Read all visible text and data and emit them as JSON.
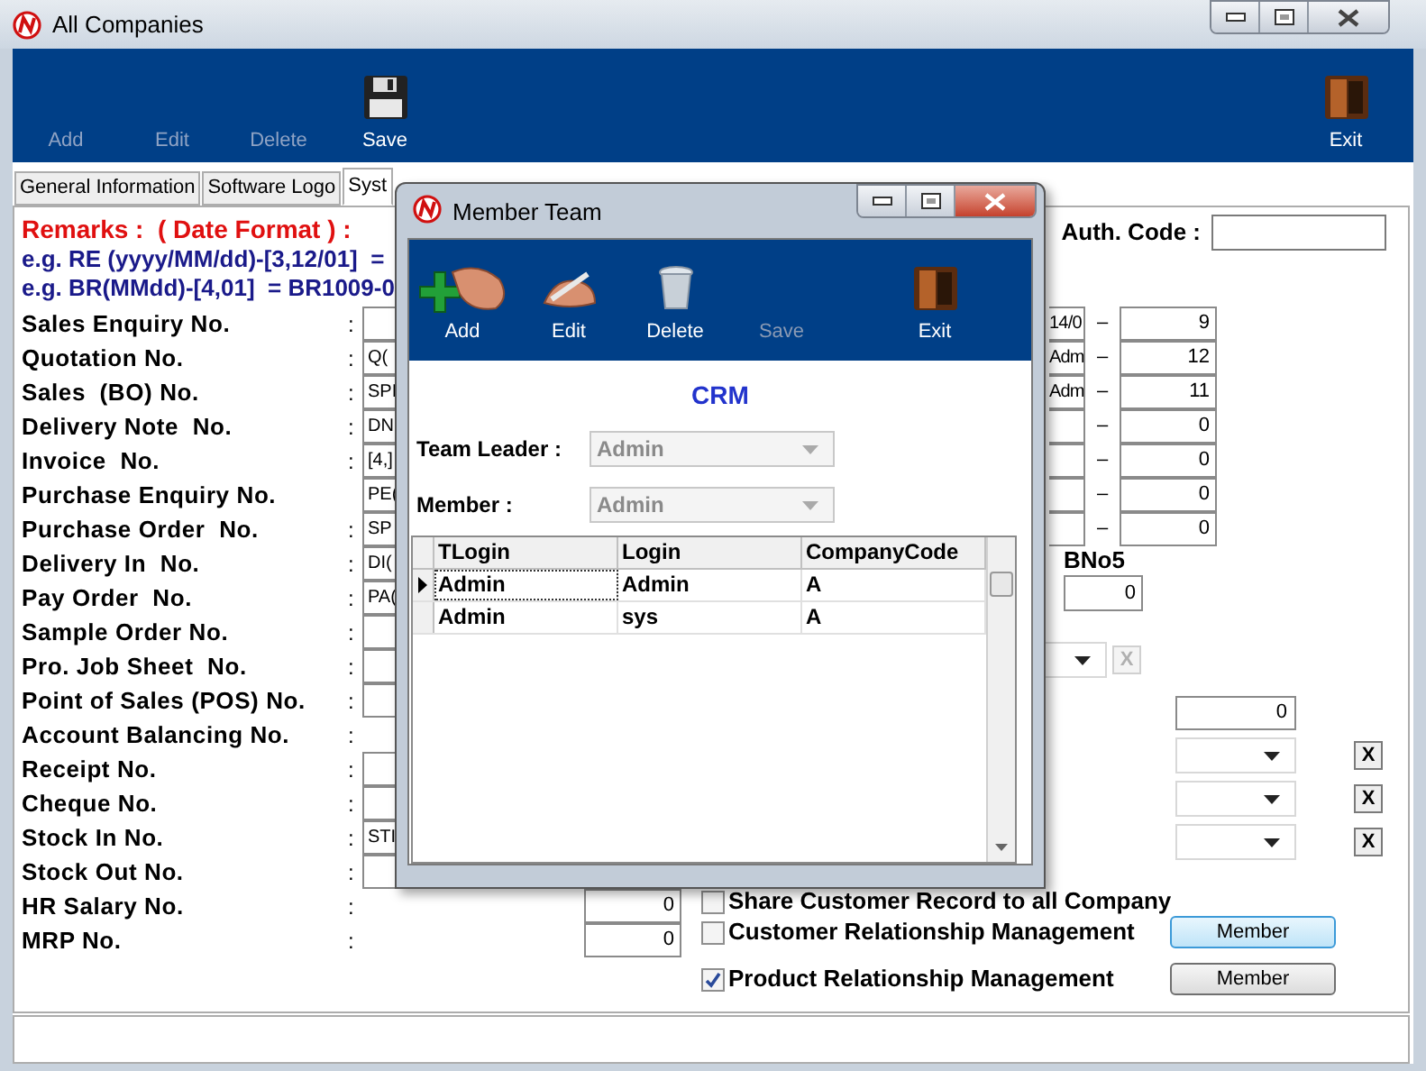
{
  "window": {
    "title": "All Companies"
  },
  "toolbar": [
    {
      "kind": "add",
      "label": "Add",
      "disabled": true
    },
    {
      "kind": "edit",
      "label": "Edit",
      "disabled": true
    },
    {
      "kind": "delete",
      "label": "Delete",
      "disabled": true
    },
    {
      "kind": "save",
      "label": "Save",
      "disabled": false
    },
    {
      "kind": "exit",
      "label": "Exit",
      "disabled": false
    }
  ],
  "tabs": [
    {
      "label": "General Information",
      "selected": false
    },
    {
      "label": "Software Logo",
      "selected": false
    },
    {
      "label": "Syst",
      "selected": true
    }
  ],
  "remarks": {
    "title": "Remarks :  ( Date Format ) :",
    "examples": [
      "e.g. RE (yyyy/MM/dd)-[3,12/01]  =",
      "e.g. BR(MMdd)-[4,01]  = BR1009-0"
    ]
  },
  "auth_code": {
    "label": "Auth. Code :"
  },
  "numbering": [
    {
      "label": "Sales Enquiry No.",
      "colon": ":",
      "kind": "field"
    },
    {
      "label": "Quotation No.",
      "colon": ":",
      "kind": "field",
      "value": "Q("
    },
    {
      "label": "Sales  (BO) No.",
      "colon": ":",
      "kind": "field",
      "value": "SPI"
    },
    {
      "label": "Delivery Note  No.",
      "colon": ":",
      "kind": "field",
      "value": "DN"
    },
    {
      "label": "Invoice  No.",
      "colon": ":",
      "kind": "field",
      "value": "[4,]"
    },
    {
      "label": "Purchase Enquiry No.",
      "kind": "field",
      "value": "PE("
    },
    {
      "label": "Purchase Order  No.",
      "colon": ":",
      "kind": "field",
      "value": "SP"
    },
    {
      "label": "Delivery In  No.",
      "colon": ":",
      "kind": "field",
      "value": "DI("
    },
    {
      "label": "Pay Order  No.",
      "colon": ":",
      "kind": "field",
      "value": "PA("
    },
    {
      "label": "Sample Order No.",
      "colon": ":",
      "kind": "field"
    },
    {
      "label": "Pro. Job Sheet  No.",
      "colon": ":",
      "kind": "field"
    },
    {
      "label": "Point of Sales (POS) No.",
      "colon": ":",
      "kind": "field"
    },
    {
      "label": "Account Balancing No.",
      "colon": ":",
      "kind": "plain"
    },
    {
      "label": "Receipt No.",
      "colon": ":",
      "kind": "field"
    },
    {
      "label": "Cheque No.",
      "colon": ":",
      "kind": "field"
    },
    {
      "label": "Stock In No.",
      "colon": ":",
      "kind": "field",
      "value": "STI"
    },
    {
      "label": "Stock Out No.",
      "colon": ":",
      "kind": "field"
    },
    {
      "label": "HR Salary No.",
      "colon": ":",
      "kind": "number",
      "value": "0"
    },
    {
      "label": "MRP No.",
      "colon": ":",
      "kind": "number",
      "value": "0"
    }
  ],
  "counters": [
    {
      "prefix": "14/0",
      "dash": "–",
      "value": "9"
    },
    {
      "prefix": "Adm",
      "dash": "–",
      "value": "12"
    },
    {
      "prefix": "Adm",
      "dash": "–",
      "value": "11"
    },
    {
      "dash": "–",
      "value": "0"
    },
    {
      "dash": "–",
      "value": "0"
    },
    {
      "dash": "–",
      "value": "0"
    },
    {
      "dash": "–",
      "value": "0"
    }
  ],
  "bno5": {
    "label": "BNo5",
    "value": "0"
  },
  "combo_rows": [
    {
      "kind": "combo",
      "clear": "X",
      "disabled": true
    },
    {
      "kind": "number",
      "value": "0"
    },
    {
      "kind": "combo",
      "clear": "X",
      "disabled": false
    },
    {
      "kind": "combo",
      "clear": "X",
      "disabled": false
    },
    {
      "kind": "combo",
      "clear": "X",
      "disabled": false
    }
  ],
  "options": [
    {
      "label": "Share Customer Record to all Company",
      "checked": false
    },
    {
      "label": "Customer Relationship Management",
      "checked": false,
      "button": {
        "label": "Member",
        "focused": true
      }
    },
    {
      "label": "Product Relationship Management",
      "checked": true,
      "button": {
        "label": "Member",
        "focused": false
      }
    }
  ],
  "dialog": {
    "title": "Member Team",
    "toolbar": [
      {
        "kind": "add",
        "label": "Add",
        "disabled": false
      },
      {
        "kind": "edit",
        "label": "Edit",
        "disabled": false
      },
      {
        "kind": "delete",
        "label": "Delete",
        "disabled": false
      },
      {
        "kind": "save",
        "label": "Save",
        "disabled": true
      },
      {
        "kind": "exit",
        "label": "Exit",
        "disabled": false
      }
    ],
    "heading": "CRM",
    "fields": [
      {
        "label": "Team Leader :",
        "value": "Admin",
        "disabled": true
      },
      {
        "label": "Member :",
        "value": "Admin",
        "disabled": true
      }
    ],
    "grid": {
      "columns": [
        "TLogin",
        "Login",
        "CompanyCode"
      ],
      "rows": [
        {
          "cells": [
            "Admin",
            "Admin",
            "A"
          ],
          "selected": true
        },
        {
          "cells": [
            "Admin",
            "sys",
            "A"
          ],
          "selected": false
        }
      ]
    }
  }
}
